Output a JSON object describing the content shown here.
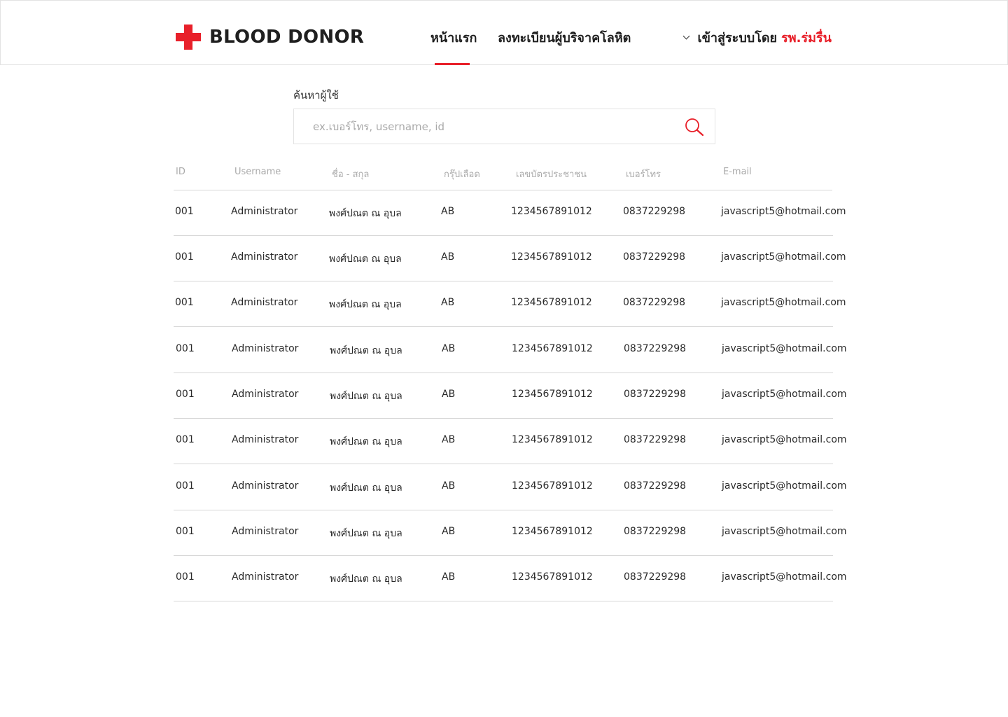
{
  "brand": {
    "name": "BLOOD DONOR",
    "logo_icon": "red-cross-icon",
    "accent": "#e8202a"
  },
  "nav": {
    "home": "หน้าแรก",
    "register": "ลงทะเบียนผู้บริจาคโลหิต",
    "active": "home"
  },
  "login": {
    "prefix": "เข้าสู่ระบบโดย",
    "hospital": "รพ.ร่มรื่น",
    "icon": "chevron-down-icon"
  },
  "search": {
    "label": "ค้นหาผู้ใช้",
    "placeholder": "ex.เบอร์โทร, username, id",
    "value": "",
    "icon": "search-icon"
  },
  "table": {
    "headers": [
      "ID",
      "Username",
      "ชื่อ - สกุล",
      "กรุ๊ปเลือด",
      "เลขบัตรประชาชน",
      "เบอร์โทร",
      "E-mail"
    ],
    "rows": [
      [
        "001",
        "Administrator",
        "พงศ์ปณต ณ อุบล",
        "AB",
        "1234567891012",
        "0837229298",
        "javascript5@hotmail.com"
      ],
      [
        "001",
        "Administrator",
        "พงศ์ปณต ณ อุบล",
        "AB",
        "1234567891012",
        "0837229298",
        "javascript5@hotmail.com"
      ],
      [
        "001",
        "Administrator",
        "พงศ์ปณต ณ อุบล",
        "AB",
        "1234567891012",
        "0837229298",
        "javascript5@hotmail.com"
      ],
      [
        "001",
        "Administrator",
        "พงศ์ปณต ณ อุบล",
        "AB",
        "1234567891012",
        "0837229298",
        "javascript5@hotmail.com"
      ],
      [
        "001",
        "Administrator",
        "พงศ์ปณต ณ อุบล",
        "AB",
        "1234567891012",
        "0837229298",
        "javascript5@hotmail.com"
      ],
      [
        "001",
        "Administrator",
        "พงศ์ปณต ณ อุบล",
        "AB",
        "1234567891012",
        "0837229298",
        "javascript5@hotmail.com"
      ],
      [
        "001",
        "Administrator",
        "พงศ์ปณต ณ อุบล",
        "AB",
        "1234567891012",
        "0837229298",
        "javascript5@hotmail.com"
      ],
      [
        "001",
        "Administrator",
        "พงศ์ปณต ณ อุบล",
        "AB",
        "1234567891012",
        "0837229298",
        "javascript5@hotmail.com"
      ],
      [
        "001",
        "Administrator",
        "พงศ์ปณต ณ อุบล",
        "AB",
        "1234567891012",
        "0837229298",
        "javascript5@hotmail.com"
      ]
    ]
  }
}
